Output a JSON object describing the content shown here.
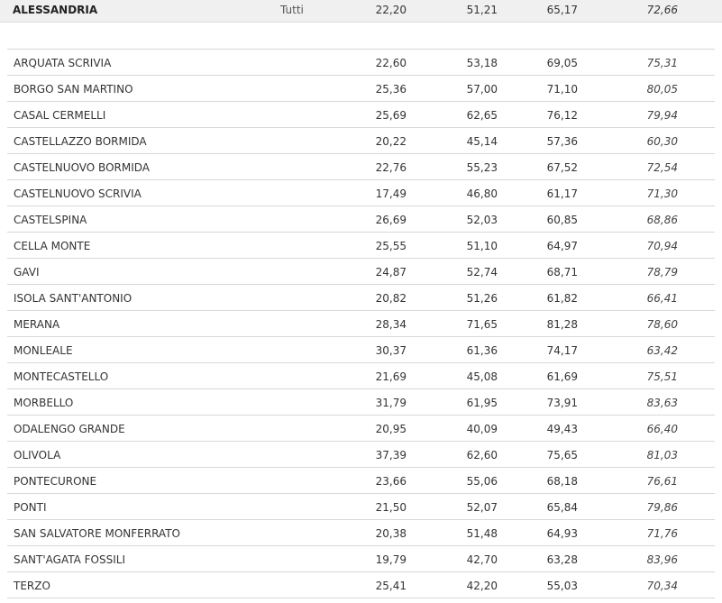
{
  "summary": {
    "name": "ALESSANDRIA",
    "scope": "Tutti",
    "v1": "22,20",
    "v2": "51,21",
    "v3": "65,17",
    "v4": "72,66"
  },
  "rows": [
    {
      "name": "ARQUATA SCRIVIA",
      "v1": "22,60",
      "v2": "53,18",
      "v3": "69,05",
      "v4": "75,31"
    },
    {
      "name": "BORGO SAN MARTINO",
      "v1": "25,36",
      "v2": "57,00",
      "v3": "71,10",
      "v4": "80,05"
    },
    {
      "name": "CASAL CERMELLI",
      "v1": "25,69",
      "v2": "62,65",
      "v3": "76,12",
      "v4": "79,94"
    },
    {
      "name": "CASTELLAZZO BORMIDA",
      "v1": "20,22",
      "v2": "45,14",
      "v3": "57,36",
      "v4": "60,30"
    },
    {
      "name": "CASTELNUOVO BORMIDA",
      "v1": "22,76",
      "v2": "55,23",
      "v3": "67,52",
      "v4": "72,54"
    },
    {
      "name": "CASTELNUOVO SCRIVIA",
      "v1": "17,49",
      "v2": "46,80",
      "v3": "61,17",
      "v4": "71,30"
    },
    {
      "name": "CASTELSPINA",
      "v1": "26,69",
      "v2": "52,03",
      "v3": "60,85",
      "v4": "68,86"
    },
    {
      "name": "CELLA MONTE",
      "v1": "25,55",
      "v2": "51,10",
      "v3": "64,97",
      "v4": "70,94"
    },
    {
      "name": "GAVI",
      "v1": "24,87",
      "v2": "52,74",
      "v3": "68,71",
      "v4": "78,79"
    },
    {
      "name": "ISOLA SANT'ANTONIO",
      "v1": "20,82",
      "v2": "51,26",
      "v3": "61,82",
      "v4": "66,41"
    },
    {
      "name": "MERANA",
      "v1": "28,34",
      "v2": "71,65",
      "v3": "81,28",
      "v4": "78,60"
    },
    {
      "name": "MONLEALE",
      "v1": "30,37",
      "v2": "61,36",
      "v3": "74,17",
      "v4": "63,42"
    },
    {
      "name": "MONTECASTELLO",
      "v1": "21,69",
      "v2": "45,08",
      "v3": "61,69",
      "v4": "75,51"
    },
    {
      "name": "MORBELLO",
      "v1": "31,79",
      "v2": "61,95",
      "v3": "73,91",
      "v4": "83,63"
    },
    {
      "name": "ODALENGO GRANDE",
      "v1": "20,95",
      "v2": "40,09",
      "v3": "49,43",
      "v4": "66,40"
    },
    {
      "name": "OLIVOLA",
      "v1": "37,39",
      "v2": "62,60",
      "v3": "75,65",
      "v4": "81,03"
    },
    {
      "name": "PONTECURONE",
      "v1": "23,66",
      "v2": "55,06",
      "v3": "68,18",
      "v4": "76,61"
    },
    {
      "name": "PONTI",
      "v1": "21,50",
      "v2": "52,07",
      "v3": "65,84",
      "v4": "79,86"
    },
    {
      "name": "SAN SALVATORE MONFERRATO",
      "v1": "20,38",
      "v2": "51,48",
      "v3": "64,93",
      "v4": "71,76"
    },
    {
      "name": "SANT'AGATA FOSSILI",
      "v1": "19,79",
      "v2": "42,70",
      "v3": "63,28",
      "v4": "83,96"
    },
    {
      "name": "TERZO",
      "v1": "25,41",
      "v2": "42,20",
      "v3": "55,03",
      "v4": "70,34"
    }
  ]
}
